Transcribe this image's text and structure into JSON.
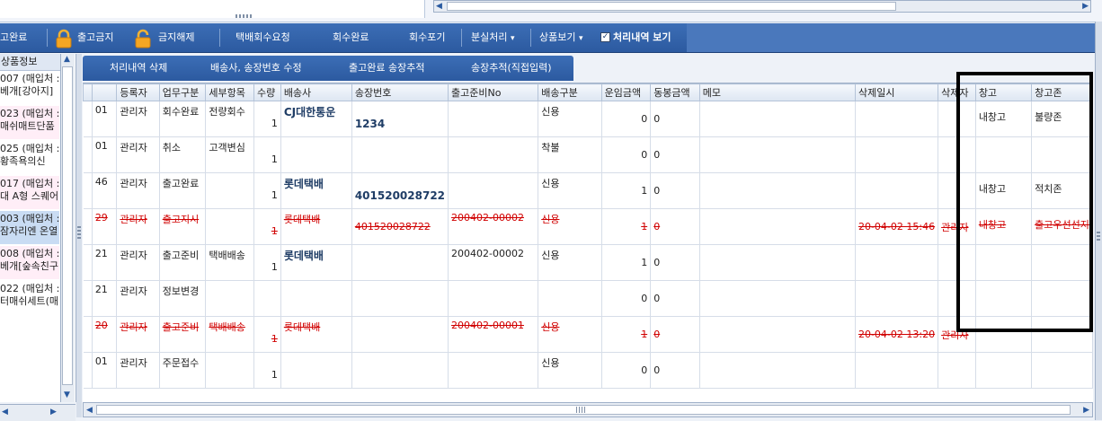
{
  "toolbar": {
    "items": [
      "고완료",
      "출고금지",
      "금지해제",
      "택배회수요청",
      "회수완료",
      "회수포기",
      "분실처리",
      "상품보기",
      "처리내역 보기"
    ],
    "dropdown_arrow": "▾",
    "checkbox_mark": "✓",
    "accent_color": "#2c5aa0"
  },
  "subtoolbar": {
    "items": [
      "처리내역 삭제",
      "배송사, 송장번호 수정",
      "출고완료 송장추적",
      "송장추적(직접입력)"
    ]
  },
  "left_panel": {
    "header": "상품정보",
    "items": [
      {
        "line1": "007 (매입처 :",
        "line2": "베개[강아지]"
      },
      {
        "line1": "023 (매입처 :",
        "line2": "매쉬매트단품"
      },
      {
        "line1": "025 (매입처 :",
        "line2": "황족욕의신"
      },
      {
        "line1": "017 (매입처 :",
        "line2": "대 A형 스퀘어"
      },
      {
        "line1": "003 (매입처 :",
        "line2": "잠자리엔 온열"
      },
      {
        "line1": "008 (매입처 :",
        "line2": "베개[숲속친구"
      },
      {
        "line1": "022 (매입처 :",
        "line2": "터매쉬세트(매"
      }
    ],
    "selected_index": 4
  },
  "grid": {
    "columns": [
      "",
      "등록자",
      "업무구분",
      "세부항목",
      "수량",
      "배송사",
      "송장번호",
      "출고준비No",
      "배송구분",
      "운임금액",
      "동봉금액",
      "메모",
      "삭제일시",
      "삭제자",
      "창고",
      "창고존"
    ],
    "rows": [
      {
        "cells": [
          "01",
          "관리자",
          "회수완료",
          "전량회수",
          "1",
          "CJ대한통운",
          "1234",
          "",
          "신용",
          "0",
          "0",
          "",
          "",
          "",
          "내창고",
          "불량존"
        ],
        "deleted": false
      },
      {
        "cells": [
          "01",
          "관리자",
          "취소",
          "고객변심",
          "1",
          "",
          "",
          "",
          "착불",
          "0",
          "0",
          "",
          "",
          "",
          "",
          ""
        ],
        "deleted": false
      },
      {
        "cells": [
          "46",
          "관리자",
          "출고완료",
          "",
          "1",
          "롯데택배",
          "401520028722",
          "",
          "신용",
          "1",
          "0",
          "",
          "",
          "",
          "내창고",
          "적치존"
        ],
        "deleted": false
      },
      {
        "cells": [
          "29",
          "관리자",
          "출고지시",
          "",
          "1",
          "롯데택배",
          "401520028722",
          "200402-00002",
          "신용",
          "1",
          "0",
          "",
          "20-04-02 15:46",
          "관리자",
          "내창고",
          "출고우선선지"
        ],
        "deleted": true
      },
      {
        "cells": [
          "21",
          "관리자",
          "출고준비",
          "택배배송",
          "1",
          "롯데택배",
          "",
          "200402-00002",
          "신용",
          "1",
          "0",
          "",
          "",
          "",
          "",
          ""
        ],
        "deleted": false
      },
      {
        "cells": [
          "21",
          "관리자",
          "정보변경",
          "",
          "",
          "",
          "",
          "",
          "",
          "0",
          "0",
          "",
          "",
          "",
          "",
          ""
        ],
        "deleted": false
      },
      {
        "cells": [
          "20",
          "관리자",
          "출고준비",
          "택배배송",
          "1",
          "롯데택배",
          "",
          "200402-00001",
          "신용",
          "1",
          "0",
          "",
          "20-04-02 13:20",
          "관리자",
          "",
          ""
        ],
        "deleted": true
      },
      {
        "cells": [
          "01",
          "관리자",
          "주문접수",
          "",
          "1",
          "",
          "",
          "",
          "신용",
          "0",
          "0",
          "",
          "",
          "",
          "",
          ""
        ],
        "deleted": false
      }
    ]
  }
}
